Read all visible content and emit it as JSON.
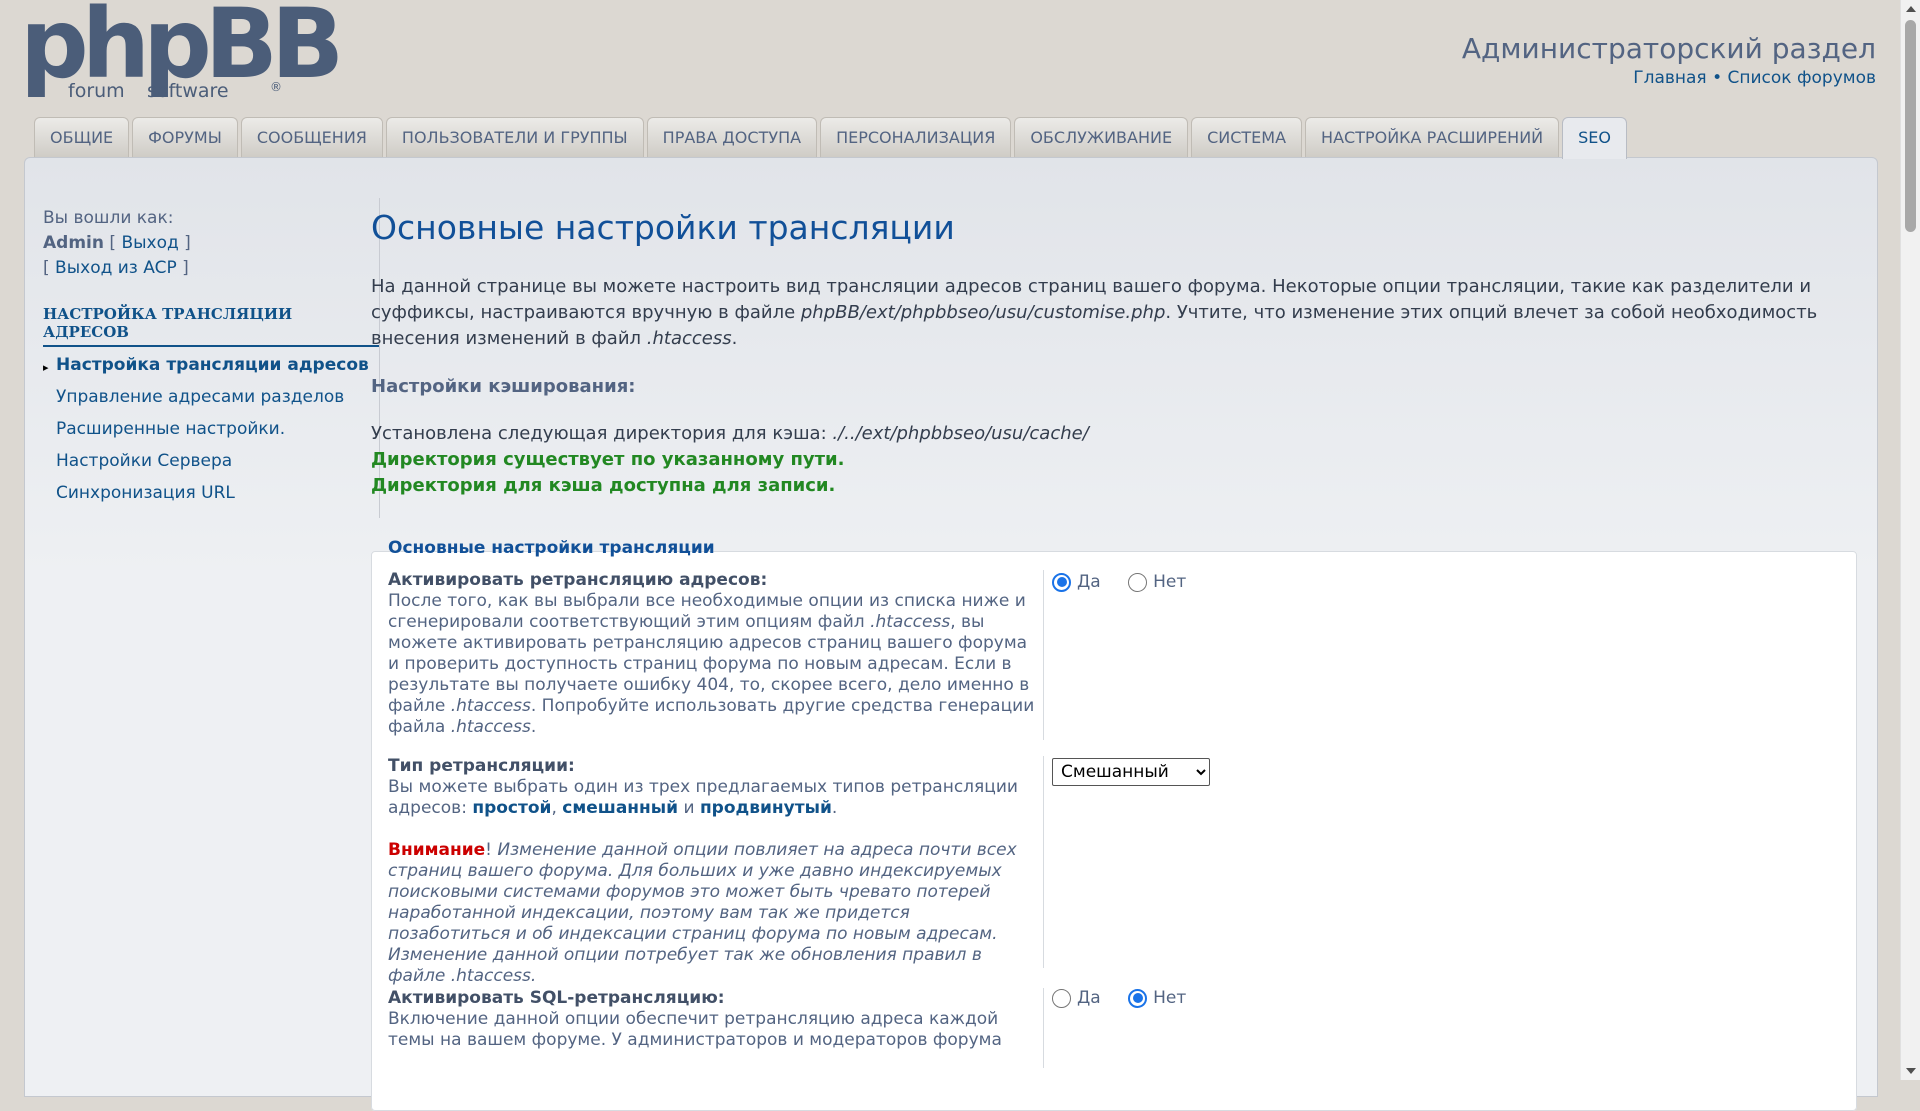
{
  "logo": {
    "word": "phpBB",
    "sub1": "forum",
    "sub2": "software",
    "reg": "®"
  },
  "header": {
    "title": "Администраторский раздел",
    "home_link": "Главная",
    "separator": "•",
    "forums_link": "Список форумов"
  },
  "tabs": [
    {
      "label": "Общие",
      "active": false
    },
    {
      "label": "Форумы",
      "active": false
    },
    {
      "label": "Сообщения",
      "active": false
    },
    {
      "label": "Пользователи и группы",
      "active": false
    },
    {
      "label": "Права доступа",
      "active": false
    },
    {
      "label": "Персонализация",
      "active": false
    },
    {
      "label": "Обслуживание",
      "active": false
    },
    {
      "label": "Система",
      "active": false
    },
    {
      "label": "Настройка расширений",
      "active": false
    },
    {
      "label": "SEO",
      "active": true
    }
  ],
  "sidebar": {
    "logged_in_as": "Вы вошли как:",
    "username": "Admin",
    "logout": "Выход",
    "logout_acp": "Выход из ACP",
    "section_title": "Настройка трансляции адресов",
    "items": [
      {
        "label": "Настройка трансляции адресов",
        "active": true
      },
      {
        "label": "Управление адресами разделов",
        "active": false
      },
      {
        "label": "Расширенные настройки.",
        "active": false
      },
      {
        "label": "Настройки Сервера",
        "active": false
      },
      {
        "label": "Синхронизация URL",
        "active": false
      }
    ]
  },
  "main": {
    "title": "Основные настройки трансляции",
    "intro_part1": "На данной странице вы можете настроить вид трансляции адресов страниц вашего форума. Некоторые опции трансляции, такие как разделители и суффиксы, настраиваются вручную в файле ",
    "intro_file": "phpBB/ext/phpbbseo/usu/customise.php",
    "intro_part2": ". Учтите, что изменение этих опций влечет за собой необходимость внесения изменений в файл ",
    "intro_htaccess": ".htaccess",
    "intro_end": ".",
    "cache_heading": "Настройки кэширования:",
    "cache_dir_label": "Установлена следующая директория для кэша: ",
    "cache_dir": "./../ext/phpbbseo/usu/cache/",
    "status_exists": "Директория существует по указанному пути.",
    "status_writable": "Директория для кэша доступна для записи."
  },
  "fieldset": {
    "legend": "Основные настройки трансляции",
    "rewrite": {
      "label": "Активировать ретрансляцию адресов:",
      "explain_1": "После того, как вы выбрали все необходимые опции из списка ниже и сгенерировали соответствующий этим опциям файл ",
      "htaccess": ".htaccess",
      "explain_2": ", вы можете активировать ретрансляцию адресов страниц вашего форума и проверить доступность страниц форума по новым адресам. Если в результате вы получаете ошибку 404, то, скорее всего, дело именно в файле ",
      "explain_3": ". Попробуйте использовать другие средства генерации файла ",
      "explain_4": ".",
      "yes": "Да",
      "no": "Нет",
      "value": "yes"
    },
    "type": {
      "label": "Тип ретрансляции:",
      "explain_1": "Вы можете выбрать один из трех предлагаемых типов ретрансляции адресов: ",
      "opt_simple": "простой",
      "comma": ", ",
      "opt_mixed": "смешанный",
      "and": " и ",
      "opt_advanced": "продвинутый",
      "dot": ".",
      "warning": "Внимание",
      "excl": "!",
      "warning_text_1": " Изменение данной опции повлияет на адреса почти всех страниц вашего форума. Для больших и уже давно индексируемых поисковыми системами форумов это может быть чревато потерей наработанной индексации, поэтому вам так же придется позаботиться и об индексации страниц форума по новым адресам. Изменение данной опции потребует так же обновления правил в файле ",
      "htaccess": ".htaccess",
      "warning_end": ".",
      "selected": "Смешанный"
    },
    "sql": {
      "label": "Активировать SQL-ретрансляцию:",
      "explain": "Включение данной опции обеспечит ретрансляцию адреса каждой темы на вашем форуме. У администраторов и модераторов форума",
      "yes": "Да",
      "no": "Нет",
      "value": "no"
    }
  },
  "colors": {
    "accent": "#105289",
    "heading": "#115098",
    "ok": "#228822",
    "warning": "#cc0000",
    "background": "#dcd8d2"
  }
}
